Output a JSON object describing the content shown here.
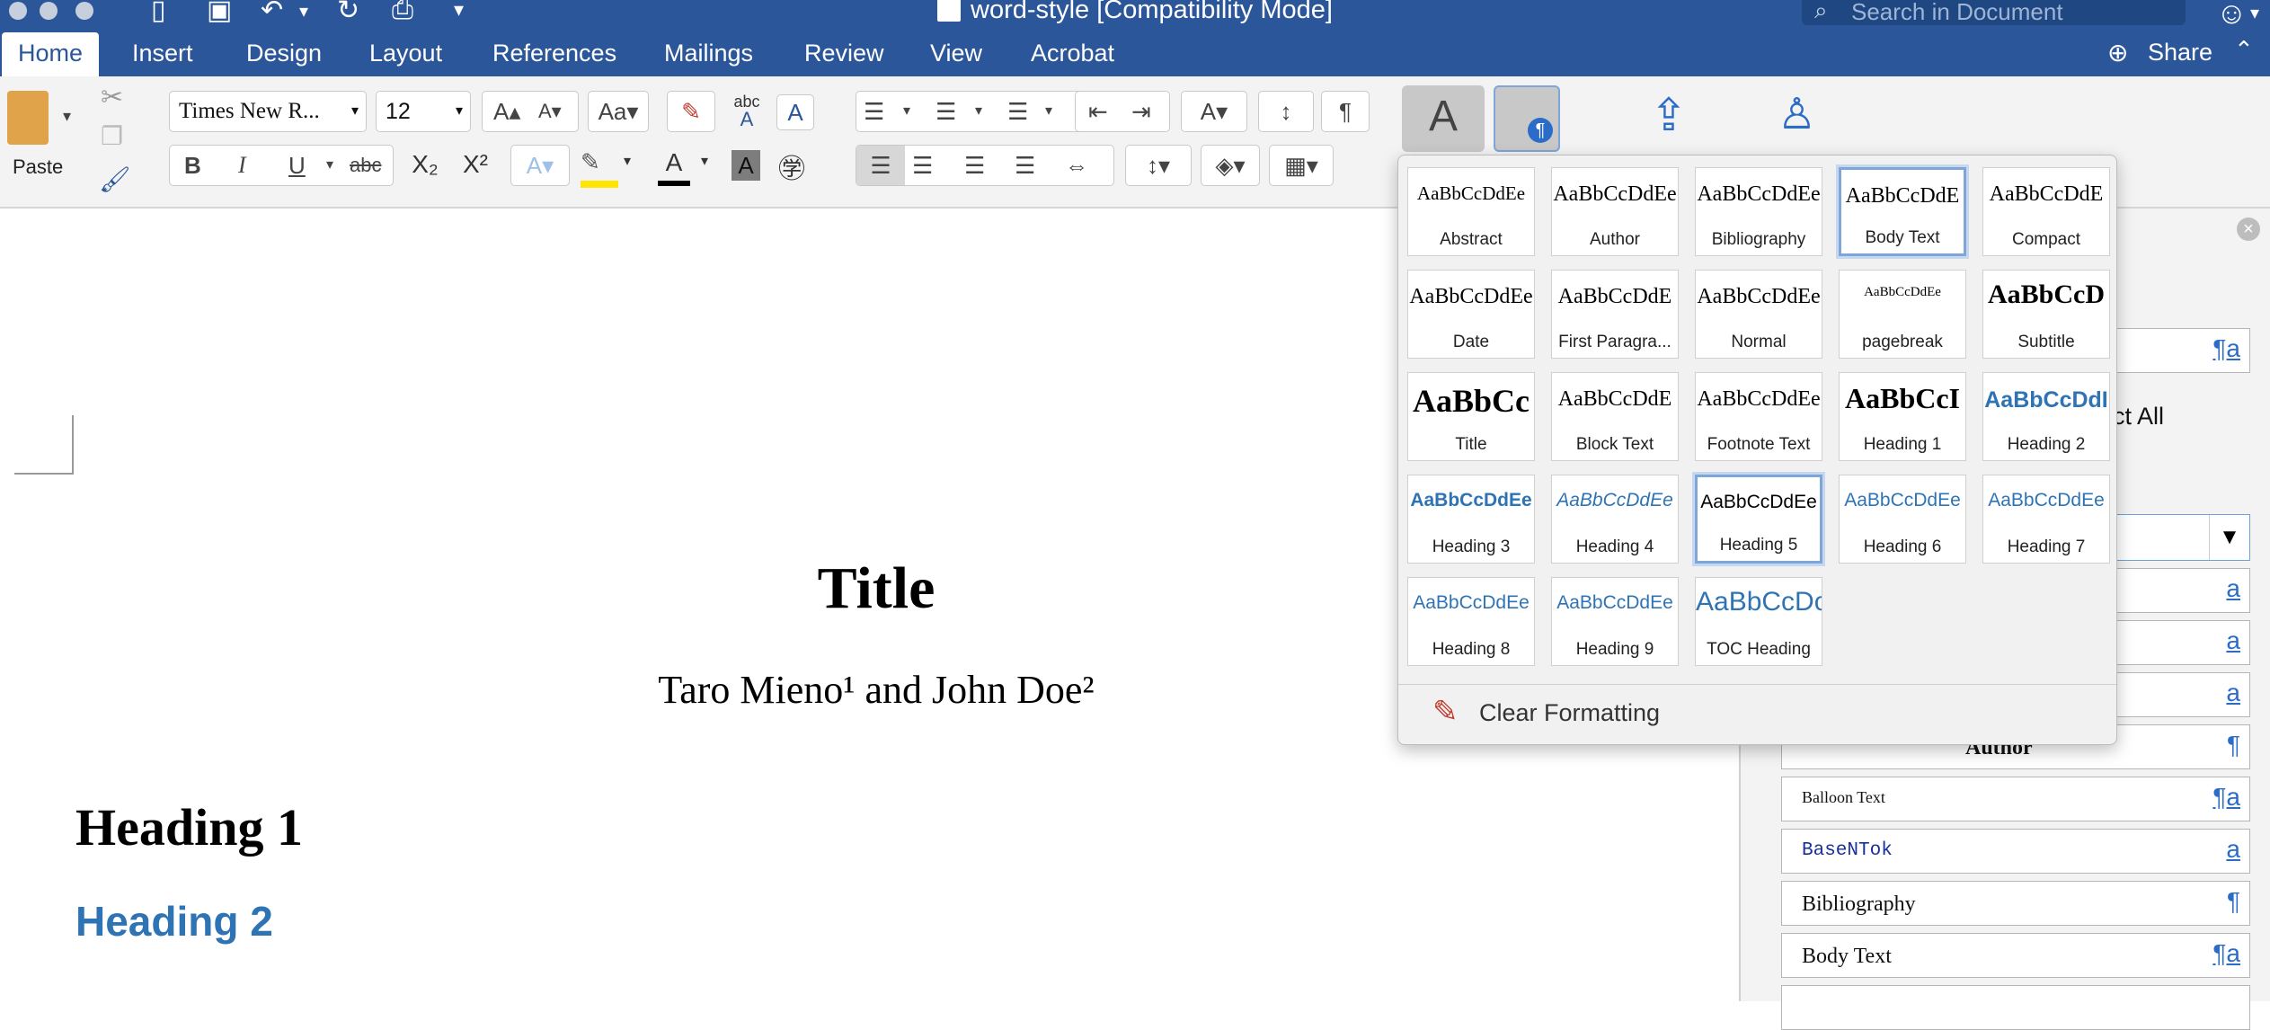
{
  "window": {
    "title": "word-style [Compatibility Mode]"
  },
  "search": {
    "placeholder": "Search in Document"
  },
  "tabs": [
    "Home",
    "Insert",
    "Design",
    "Layout",
    "References",
    "Mailings",
    "Review",
    "View",
    "Acrobat"
  ],
  "share_label": "Share",
  "ribbon": {
    "paste_label": "Paste",
    "font_name": "Times New R...",
    "font_size": "12",
    "bold": "B",
    "italic": "I",
    "underline": "U",
    "strikethrough": "abc",
    "subscript": "X₂",
    "superscript": "X²",
    "abc_label": "abc",
    "pilcrow": "¶"
  },
  "document": {
    "title": "Title",
    "author_line": "Taro Mieno¹ and John Doe²",
    "heading1": "Heading 1",
    "heading2": "Heading 2"
  },
  "gallery": {
    "styles": [
      {
        "preview": "AaBbCcDdEe",
        "label": "Abstract",
        "selected": false
      },
      {
        "preview": "AaBbCcDdEe",
        "label": "Author",
        "selected": false
      },
      {
        "preview": "AaBbCcDdEe",
        "label": "Bibliography",
        "selected": false
      },
      {
        "preview": "AaBbCcDdE",
        "label": "Body Text",
        "selected": true
      },
      {
        "preview": "AaBbCcDdE",
        "label": "Compact",
        "selected": false
      },
      {
        "preview": "AaBbCcDdEe",
        "label": "Date",
        "selected": false
      },
      {
        "preview": "AaBbCcDdE",
        "label": "First Paragra...",
        "selected": false
      },
      {
        "preview": "AaBbCcDdEe",
        "label": "Normal",
        "selected": false
      },
      {
        "preview": "AaBbCcDdEe",
        "label": "pagebreak",
        "selected": false
      },
      {
        "preview": "AaBbCcD",
        "label": "Subtitle",
        "selected": false
      },
      {
        "preview": "AaBbCc",
        "label": "Title",
        "selected": false
      },
      {
        "preview": "AaBbCcDdE",
        "label": "Block Text",
        "selected": false
      },
      {
        "preview": "AaBbCcDdEe",
        "label": "Footnote Text",
        "selected": false
      },
      {
        "preview": "AaBbCcI",
        "label": "Heading 1",
        "selected": false
      },
      {
        "preview": "AaBbCcDdI",
        "label": "Heading 2",
        "selected": false
      },
      {
        "preview": "AaBbCcDdEe",
        "label": "Heading 3",
        "selected": false
      },
      {
        "preview": "AaBbCcDdEe",
        "label": "Heading 4",
        "selected": false
      },
      {
        "preview": "AaBbCcDdEe",
        "label": "Heading 5",
        "selected": true
      },
      {
        "preview": "AaBbCcDdEe",
        "label": "Heading 6",
        "selected": false
      },
      {
        "preview": "AaBbCcDdEe",
        "label": "Heading 7",
        "selected": false
      },
      {
        "preview": "AaBbCcDdEe",
        "label": "Heading 8",
        "selected": false
      },
      {
        "preview": "AaBbCcDdEe",
        "label": "Heading 9",
        "selected": false
      },
      {
        "preview": "AaBbCcDc",
        "label": "TOC Heading",
        "selected": false
      }
    ],
    "clear_label": "Clear Formatting"
  },
  "styles_pane": {
    "select_all_label": "lect All",
    "items": [
      {
        "name": "Author",
        "icon": "¶"
      },
      {
        "name": "Balloon Text",
        "icon": "¶a"
      },
      {
        "name": "BaseNTok",
        "icon": "a"
      },
      {
        "name": "Bibliography",
        "icon": "¶"
      },
      {
        "name": "Body Text",
        "icon": "¶a"
      }
    ],
    "generic_icons": [
      "¶a",
      "a",
      "a",
      "a",
      "a"
    ]
  },
  "colors": {
    "brand": "#2b579a",
    "accent_blue": "#2e74b5"
  }
}
